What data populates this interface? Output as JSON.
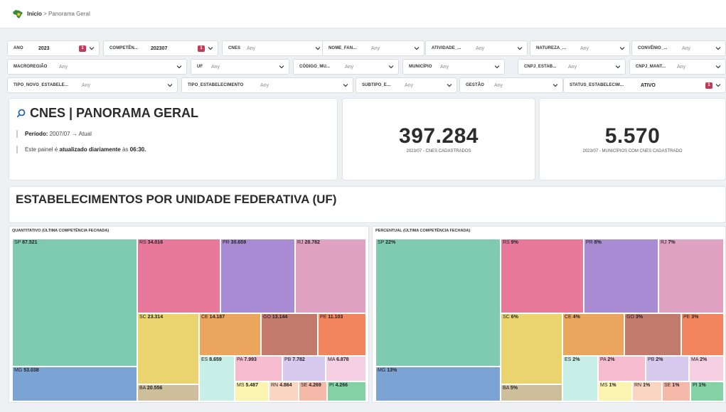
{
  "breadcrumb": {
    "home": "Início",
    "separator": ">",
    "current": "Panorama Geral"
  },
  "filters": [
    [
      {
        "label": "ANO",
        "value": "2023",
        "set": true,
        "count": "1"
      },
      {
        "label": "COMPETÊN...",
        "value": "202307",
        "set": true,
        "count": "1"
      },
      {
        "label": "CNES",
        "value": "Any",
        "set": false
      },
      {
        "label": "NOME_FAN...",
        "value": "Any",
        "set": false
      },
      {
        "label": "ATIVIDADE_...",
        "value": "Any",
        "set": false
      },
      {
        "label": "NATUREZA_...",
        "value": "Any",
        "set": false
      },
      {
        "label": "CONVÊNIO_...",
        "value": "Any",
        "set": false
      }
    ],
    [
      {
        "label": "MACROREGIÃO",
        "value": "Any",
        "set": false
      },
      {
        "label": "UF",
        "value": "Any",
        "set": false
      },
      {
        "label": "CÓDIGO_MU...",
        "value": "Any",
        "set": false
      },
      {
        "label": "MUNICÍPIO",
        "value": "Any",
        "set": false
      },
      {
        "label": "CNPJ_ESTAB...",
        "value": "Any",
        "set": false
      },
      {
        "label": "CNPJ_MANT...",
        "value": "Any",
        "set": false
      }
    ],
    [
      {
        "label": "TIPO_NOVO_ESTABELE...",
        "value": "Any",
        "set": false
      },
      {
        "label": "TIPO_ESTABELECIMENTO",
        "value": "Any",
        "set": false
      },
      {
        "label": "SUBTIPO_E...",
        "value": "Any",
        "set": false
      },
      {
        "label": "GESTÃO",
        "value": "Any",
        "set": false
      },
      {
        "label": "STATUS_ESTABELECIM...",
        "value": "ATIVO",
        "set": true,
        "count": "1"
      }
    ]
  ],
  "header": {
    "title": "CNES | PANORAMA GERAL",
    "period_label": "Período:",
    "period_value": "2007/07 → Atual",
    "update_prefix": "Este painel é",
    "update_bold": "atualizado diariamente",
    "update_suffix": "às",
    "update_time": "06:30."
  },
  "kpis": [
    {
      "value": "397.284",
      "caption": "2023/07 - CNES CADASTRADOS"
    },
    {
      "value": "5.570",
      "caption": "2023/07 - MUNICÍPIOS COM CNES CADASTRADO"
    }
  ],
  "section_title": "ESTABELECIMENTOS POR UNIDADE FEDERATIVA (UF)",
  "colors": {
    "SP": "#7ecbb1",
    "MG": "#7ba3d4",
    "RS": "#e8799a",
    "PR": "#a98bd3",
    "RJ": "#e0a2c3",
    "SC": "#e9d470",
    "BA": "#cdbf9c",
    "CE": "#eba55c",
    "GO": "#c17a6b",
    "PE": "#f2845e",
    "ES": "#c7efe7",
    "PA": "#f8bcd0",
    "PB": "#d8c9ef",
    "MA": "#f6cfe3",
    "MS": "#fbf3b0",
    "RN": "#fad6c2",
    "SE": "#f4b9a8",
    "PI": "#84d1a6",
    "badge": "#c23a5a"
  },
  "chart_data": [
    {
      "type": "treemap",
      "title": "QUANTITATIVO (ÚLTIMA COMPETÊNCIA FECHADA)",
      "series": [
        {
          "label": "SP",
          "value": 87521,
          "text": "87.521"
        },
        {
          "label": "MG",
          "value": 53038,
          "text": "53.038"
        },
        {
          "label": "RS",
          "value": 34016,
          "text": "34.016"
        },
        {
          "label": "PR",
          "value": 30659,
          "text": "30.659"
        },
        {
          "label": "RJ",
          "value": 28782,
          "text": "28.782"
        },
        {
          "label": "SC",
          "value": 23314,
          "text": "23.314"
        },
        {
          "label": "BA",
          "value": 20556,
          "text": "20.556"
        },
        {
          "label": "CE",
          "value": 14187,
          "text": "14.187"
        },
        {
          "label": "GO",
          "value": 13144,
          "text": "13.144"
        },
        {
          "label": "PE",
          "value": 11103,
          "text": "11.103"
        },
        {
          "label": "ES",
          "value": 8659,
          "text": "8.659"
        },
        {
          "label": "PA",
          "value": 7993,
          "text": "7.993"
        },
        {
          "label": "PB",
          "value": 7782,
          "text": "7.782"
        },
        {
          "label": "MA",
          "value": 6878,
          "text": "6.878"
        },
        {
          "label": "MS",
          "value": 5487,
          "text": "5.487"
        },
        {
          "label": "RN",
          "value": 4864,
          "text": "4.864"
        },
        {
          "label": "SE",
          "value": 4269,
          "text": "4.269"
        },
        {
          "label": "PI",
          "value": 4266,
          "text": "4.266"
        }
      ]
    },
    {
      "type": "treemap",
      "title": "PERCENTUAL (ÚLTIMA COMPETÊNCIA FECHADA)",
      "series": [
        {
          "label": "SP",
          "value": 22,
          "text": "22%"
        },
        {
          "label": "MG",
          "value": 13,
          "text": "13%"
        },
        {
          "label": "RS",
          "value": 9,
          "text": "9%"
        },
        {
          "label": "PR",
          "value": 8,
          "text": "8%"
        },
        {
          "label": "RJ",
          "value": 7,
          "text": "7%"
        },
        {
          "label": "SC",
          "value": 6,
          "text": "6%"
        },
        {
          "label": "BA",
          "value": 5,
          "text": "5%"
        },
        {
          "label": "CE",
          "value": 4,
          "text": "4%"
        },
        {
          "label": "GO",
          "value": 3,
          "text": "3%"
        },
        {
          "label": "PE",
          "value": 3,
          "text": "3%"
        },
        {
          "label": "ES",
          "value": 2,
          "text": "2%"
        },
        {
          "label": "PA",
          "value": 2,
          "text": "2%"
        },
        {
          "label": "PB",
          "value": 2,
          "text": "2%"
        },
        {
          "label": "MA",
          "value": 2,
          "text": "2%"
        },
        {
          "label": "MS",
          "value": 1,
          "text": "1%"
        },
        {
          "label": "RN",
          "value": 1,
          "text": "1%"
        },
        {
          "label": "SE",
          "value": 1,
          "text": "1%"
        },
        {
          "label": "PI",
          "value": 1,
          "text": "1%"
        }
      ]
    }
  ]
}
